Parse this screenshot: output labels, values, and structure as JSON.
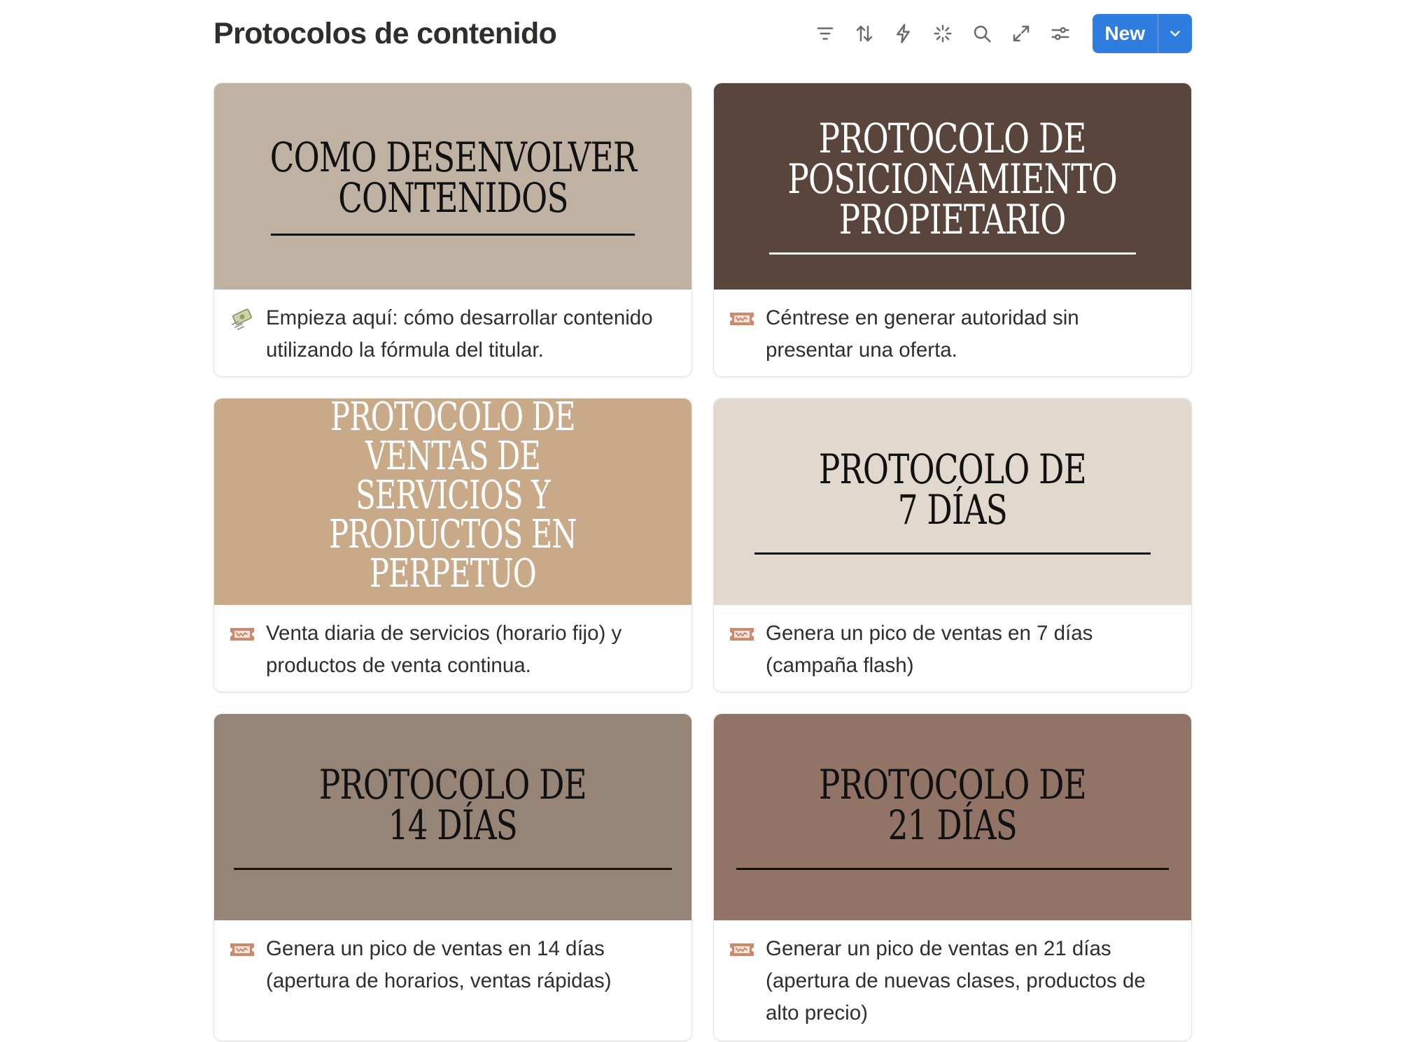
{
  "header": {
    "title": "Protocolos de contenido",
    "new_label": "New"
  },
  "toolbar_icons": [
    "filter-icon",
    "sort-icon",
    "lightning-icon",
    "ai-sparkle-icon",
    "search-icon",
    "expand-icon",
    "settings-sliders-icon"
  ],
  "colors": {
    "accent": "#2f7de1",
    "card_1_cover": "#c0b2a2",
    "card_2_cover": "#59453b",
    "card_3_cover": "#c9aa88",
    "card_4_cover": "#e1d9ce",
    "card_5_cover": "#968576",
    "card_6_cover": "#917465"
  },
  "cards": [
    {
      "cover_title": "COMO DESENVOLVER\nCONTENIDOS",
      "icon": "money-with-wings-icon",
      "caption": "Empieza aquí: cómo desarrollar contenido utilizando la fórmula del titular."
    },
    {
      "cover_title": "PROTOCOLO DE\nPOSICIONAMIENTO\nPROPIETARIO",
      "icon": "ticket-icon",
      "caption": "Céntrese en generar autoridad sin presentar una oferta."
    },
    {
      "cover_title": "PROTOCOLO DE VENTAS DE\nSERVICIOS Y PRODUCTOS EN\nPERPETUO",
      "icon": "ticket-icon",
      "caption": "Venta diaria de servicios (horario fijo) y productos de venta continua."
    },
    {
      "cover_title": "PROTOCOLO DE\n7 DÍAS",
      "icon": "ticket-icon",
      "caption": "Genera un pico de ventas en 7 días (campaña flash)"
    },
    {
      "cover_title": "PROTOCOLO DE\n14 DÍAS",
      "icon": "ticket-icon",
      "caption": "Genera un pico de ventas en 14 días (apertura de horarios, ventas rápidas)"
    },
    {
      "cover_title": "PROTOCOLO DE\n21 DÍAS",
      "icon": "ticket-icon",
      "caption": "Generar un pico de ventas en 21 días (apertura de nuevas clases, productos de alto precio)"
    }
  ]
}
